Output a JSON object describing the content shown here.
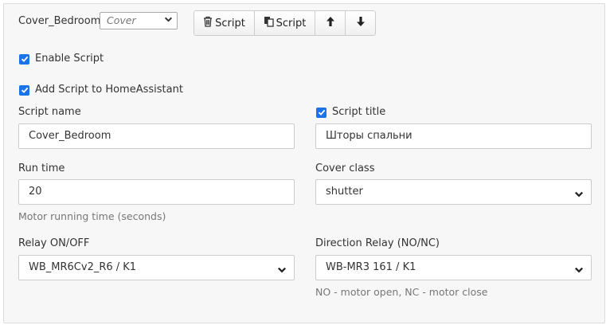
{
  "header": {
    "script_name": "Cover_Bedroom",
    "type_select": {
      "value": "Cover"
    },
    "buttons": [
      {
        "icon": "trash-icon",
        "label": "Script"
      },
      {
        "icon": "copy-icon",
        "label": "Script"
      },
      {
        "icon": "arrow-up-icon",
        "label": ""
      },
      {
        "icon": "arrow-down-icon",
        "label": ""
      }
    ]
  },
  "options": {
    "enable_script": {
      "label": "Enable Script",
      "checked": true
    },
    "add_to_ha": {
      "label": "Add Script to HomeAssistant",
      "checked": true
    }
  },
  "form": {
    "script_name": {
      "label": "Script name",
      "value": "Cover_Bedroom"
    },
    "script_title": {
      "label": "Script title",
      "checked": true,
      "value": "Шторы спальни"
    },
    "run_time": {
      "label": "Run time",
      "value": "20",
      "help": "Motor running time (seconds)"
    },
    "cover_class": {
      "label": "Cover class",
      "value": "shutter"
    },
    "relay_onoff": {
      "label": "Relay ON/OFF",
      "value": "WB_MR6Cv2_R6 / K1"
    },
    "direction_relay": {
      "label": "Direction Relay (NO/NC)",
      "value": "WB-MR3 161 / K1",
      "help": "NO - motor open, NC - motor close"
    }
  },
  "colors": {
    "accent": "#1a73e8",
    "panel_bg": "#f7f7f7",
    "border": "#cccccc",
    "help_text": "#777777"
  }
}
